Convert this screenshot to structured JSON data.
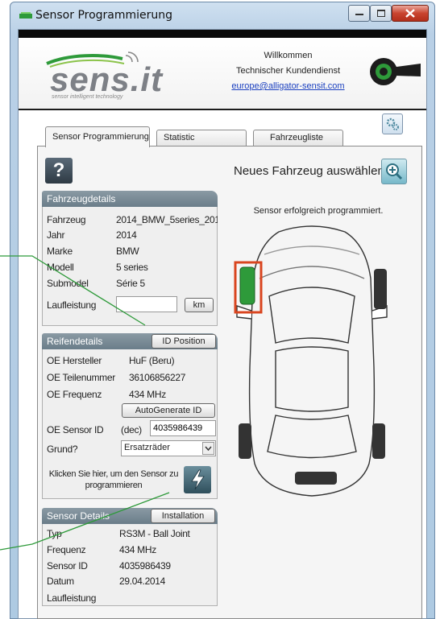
{
  "window": {
    "title": "Sensor Programmierung"
  },
  "header": {
    "logo_text": "sens.it",
    "logo_tagline": "sensor intelligent technology",
    "welcome_line1": "Willkommen",
    "welcome_line2": "Technischer Kundendienst",
    "email": "europe@alligator-sensit.com"
  },
  "tabs": [
    "Sensor Programmierung",
    "Statistic",
    "Fahrzeugliste"
  ],
  "main": {
    "help_label": "?",
    "new_vehicle": "Neues Fahrzeug auswählen.",
    "status": "Sensor erfolgreich programmiert."
  },
  "vehicle": {
    "title": "Fahrzeugdetails",
    "rows": [
      {
        "label": "Fahrzeug",
        "value": "2014_BMW_5series_201"
      },
      {
        "label": "Jahr",
        "value": "2014"
      },
      {
        "label": "Marke",
        "value": "BMW"
      },
      {
        "label": "Modell",
        "value": "5 series"
      },
      {
        "label": "Submodel",
        "value": "Série 5"
      }
    ],
    "mileage_label": "Laufleistung",
    "mileage_value": "",
    "unit_button": "km"
  },
  "tyre": {
    "title": "Reifendetails",
    "id_position_button": "ID Position",
    "rows": [
      {
        "label": "OE Hersteller",
        "value": "HuF (Beru)"
      },
      {
        "label": "OE Teilenummer",
        "value": "36106856227"
      },
      {
        "label": "OE Frequenz",
        "value": "434 MHz"
      }
    ],
    "autogenerate_button": "AutoGenerate ID",
    "sensor_id_label": "OE Sensor ID",
    "sensor_id_mode": "(dec)",
    "sensor_id_value": "4035986439",
    "reason_label": "Grund?",
    "reason_value": "Ersatzräder",
    "program_text": "Klicken Sie hier, um den Sensor zu programmieren"
  },
  "sensor": {
    "title": "Sensor Details",
    "installation_button": "Installation",
    "rows": [
      {
        "label": "Typ",
        "value": "RS3M - Ball Joint"
      },
      {
        "label": "Frequenz",
        "value": "434 MHz"
      },
      {
        "label": "Sensor ID",
        "value": "4035986439"
      },
      {
        "label": "Datum",
        "value": "29.04.2014"
      },
      {
        "label": "Laufleistung",
        "value": ""
      }
    ]
  },
  "colors": {
    "section_header": "#7a8b96",
    "active_wheel": "#2e9a3a",
    "highlight_box": "#d9451f",
    "callout_line": "#2e9a3a"
  },
  "icons": {
    "gear": "settings-gear-icon",
    "zoom": "zoom-plus-icon",
    "flash": "lightning-icon",
    "dropdown": "chevron-down-icon"
  }
}
